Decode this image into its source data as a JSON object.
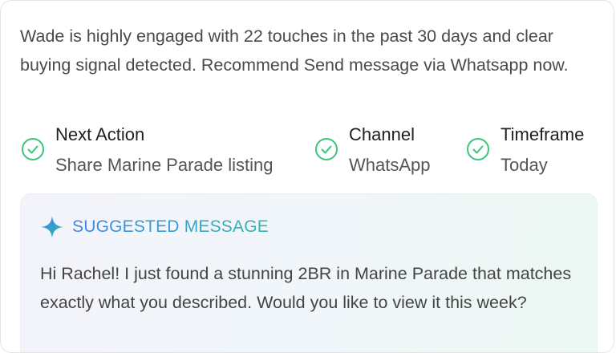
{
  "summary": "Wade is highly engaged with 22 touches in the past 30 days and clear buying signal detected. Recommend Send message via Whatsapp now.",
  "items": [
    {
      "label": "Next Action",
      "value": "Share Marine Parade listing",
      "icon": "check-circle-icon"
    },
    {
      "label": "Channel",
      "value": "WhatsApp",
      "icon": "check-circle-icon"
    },
    {
      "label": "Timeframe",
      "value": "Today",
      "icon": "check-circle-icon"
    }
  ],
  "suggested": {
    "title": "SUGGESTED MESSAGE",
    "icon": "sparkle-icon",
    "body": "Hi Rachel! I just found a stunning 2BR in Marine Parade that matches exactly what you described. Would you like to view it this week?"
  },
  "colors": {
    "check": "#3cc47c",
    "accent_start": "#3b84f0",
    "accent_end": "#31b8a9"
  }
}
